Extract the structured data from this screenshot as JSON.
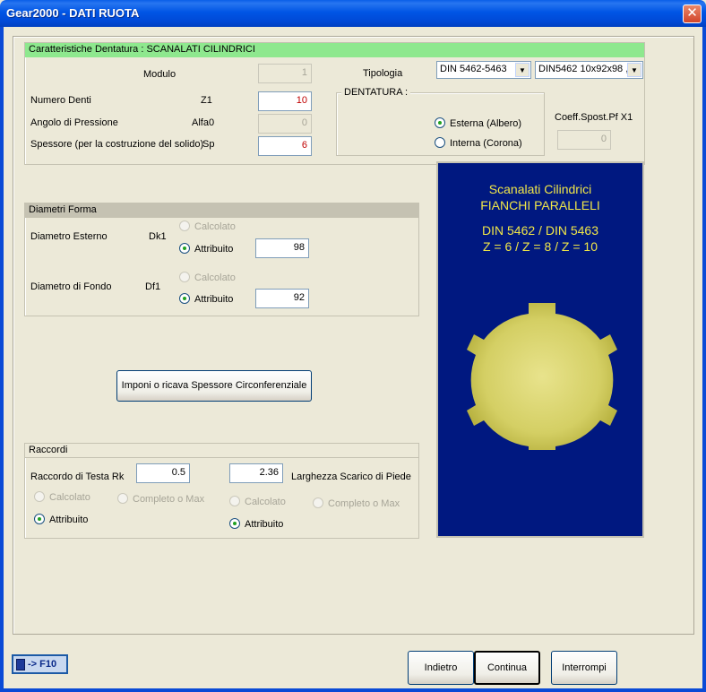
{
  "window": {
    "title": "Gear2000 - DATI RUOTA",
    "close_symbol": "✕"
  },
  "dentatura_section": {
    "header": "Caratteristiche Dentatura : SCANALATI CILINDRICI",
    "modulo_label": "Modulo",
    "modulo_value": "1",
    "numero_denti_label": "Numero Denti",
    "numero_denti_symbol": "Z1",
    "numero_denti_value": "10",
    "angolo_label": "Angolo di Pressione",
    "angolo_symbol": "Alfa0",
    "angolo_value": "0",
    "spessore_label": "Spessore (per la costruzione del solido)",
    "spessore_symbol": "Sp",
    "spessore_value": "6",
    "tipologia_label": "Tipologia",
    "tipologia_select": "DIN 5462-5463",
    "size_select": "DIN5462 10x92x98 ,",
    "dentatura_group_label": "DENTATURA :",
    "esterna_label": "Esterna (Albero)",
    "interna_label": "Interna (Corona)",
    "coeff_label": "Coeff.Spost.Pf  X1",
    "coeff_value": "0"
  },
  "diametri_section": {
    "header": "Diametri Forma",
    "esterno_label": "Diametro Esterno",
    "esterno_symbol": "Dk1",
    "esterno_value": "98",
    "fondo_label": "Diametro di Fondo",
    "fondo_symbol": "Df1",
    "fondo_value": "92",
    "calcolato_label": "Calcolato",
    "attribuito_label": "Attribuito"
  },
  "spessore_button": "Imponi o ricava Spessore Circonferenziale",
  "raccordi_section": {
    "header": "Raccordi",
    "testa_label": "Raccordo di Testa  Rk",
    "testa_value": "0.5",
    "scarico_value": "2.36",
    "scarico_label": "Larghezza Scarico di Piede",
    "calcolato_label": "Calcolato",
    "completo_label": "Completo o Max",
    "attribuito_label": "Attribuito"
  },
  "info_panel": {
    "line1": "Scanalati Cilindrici",
    "line2": "FIANCHI  PARALLELI",
    "line3": "DIN 5462 / DIN 5463",
    "line4": "Z = 6  /  Z = 8  /  Z = 10",
    "gear_color": "#d9d46a",
    "bg_color": "#001880",
    "text_color": "#f0e648"
  },
  "footer": {
    "calc_label": "-> F10",
    "indietro": "Indietro",
    "continua": "Continua",
    "interrompi": "Interrompi"
  }
}
